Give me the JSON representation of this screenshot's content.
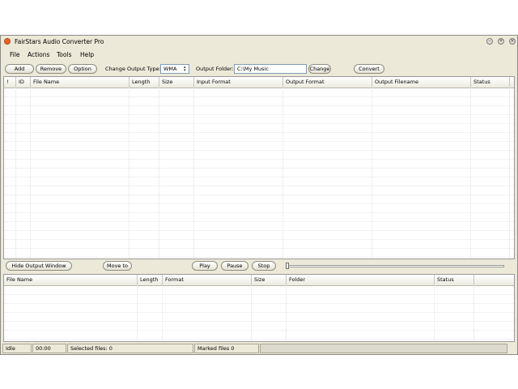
{
  "window": {
    "title": "FairStars Audio Converter Pro"
  },
  "menu": [
    {
      "label": "File"
    },
    {
      "label": "Actions"
    },
    {
      "label": "Tools"
    },
    {
      "label": "Help"
    }
  ],
  "toolbar": {
    "add": "Add",
    "remove": "Remove",
    "option": "Option",
    "output_type_label": "Change Output Type:",
    "output_type_value": "WMA",
    "output_folder_label": "Output Folder:",
    "output_folder_value": "C:\\My Music",
    "change": "Change",
    "convert": "Convert"
  },
  "file_table": {
    "columns": [
      "!",
      "ID",
      "File Name",
      "Length",
      "Size",
      "Input Format",
      "Output Format",
      "Output Filename",
      "Status"
    ],
    "rows": []
  },
  "controls": {
    "hide_output": "Hide Output Window",
    "move_to": "Move to",
    "play": "Play",
    "pause": "Pause",
    "stop": "Stop",
    "position": 0
  },
  "output_table": {
    "columns": [
      "File Name",
      "Length",
      "Format",
      "Size",
      "Folder",
      "Status"
    ],
    "rows": []
  },
  "status": {
    "state": "Idle",
    "time": "00:00",
    "selected": "Selected files: 0",
    "marked": "Marked files 0"
  },
  "colors": {
    "chrome": "#ece9d8",
    "app_icon": "#e8632a"
  }
}
